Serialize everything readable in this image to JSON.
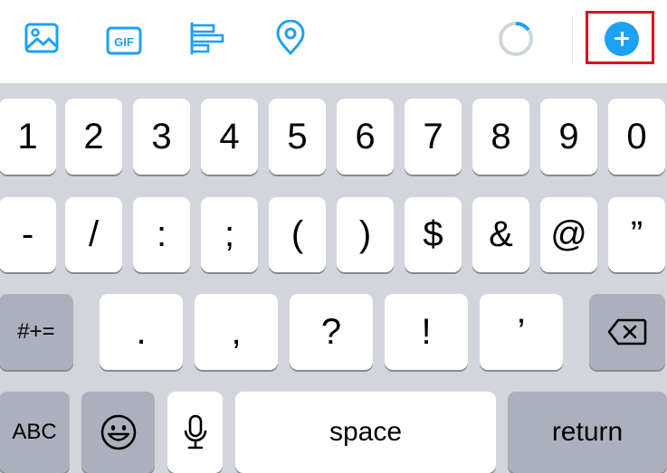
{
  "toolbar": {
    "icons": [
      "image-icon",
      "gif-icon",
      "poll-icon",
      "location-icon"
    ],
    "gif_label": "GIF",
    "progress_ring_fraction": 0.15,
    "add_button_icon": "plus-icon",
    "accent_color": "#1da1f2",
    "highlight_color": "#e0001b"
  },
  "keyboard": {
    "row1": [
      "1",
      "2",
      "3",
      "4",
      "5",
      "6",
      "7",
      "8",
      "9",
      "0"
    ],
    "row2": [
      "-",
      "/",
      ":",
      ";",
      "(",
      ")",
      "$",
      "&",
      "@",
      "”"
    ],
    "row3": {
      "symbols_toggle": "#+=",
      "keys": [
        ".",
        ",",
        "?",
        "!",
        "’"
      ],
      "delete_icon": "backspace-icon"
    },
    "row4": {
      "abc": "ABC",
      "emoji_icon": "emoji-icon",
      "mic_icon": "microphone-icon",
      "space": "space",
      "return": "return"
    }
  }
}
